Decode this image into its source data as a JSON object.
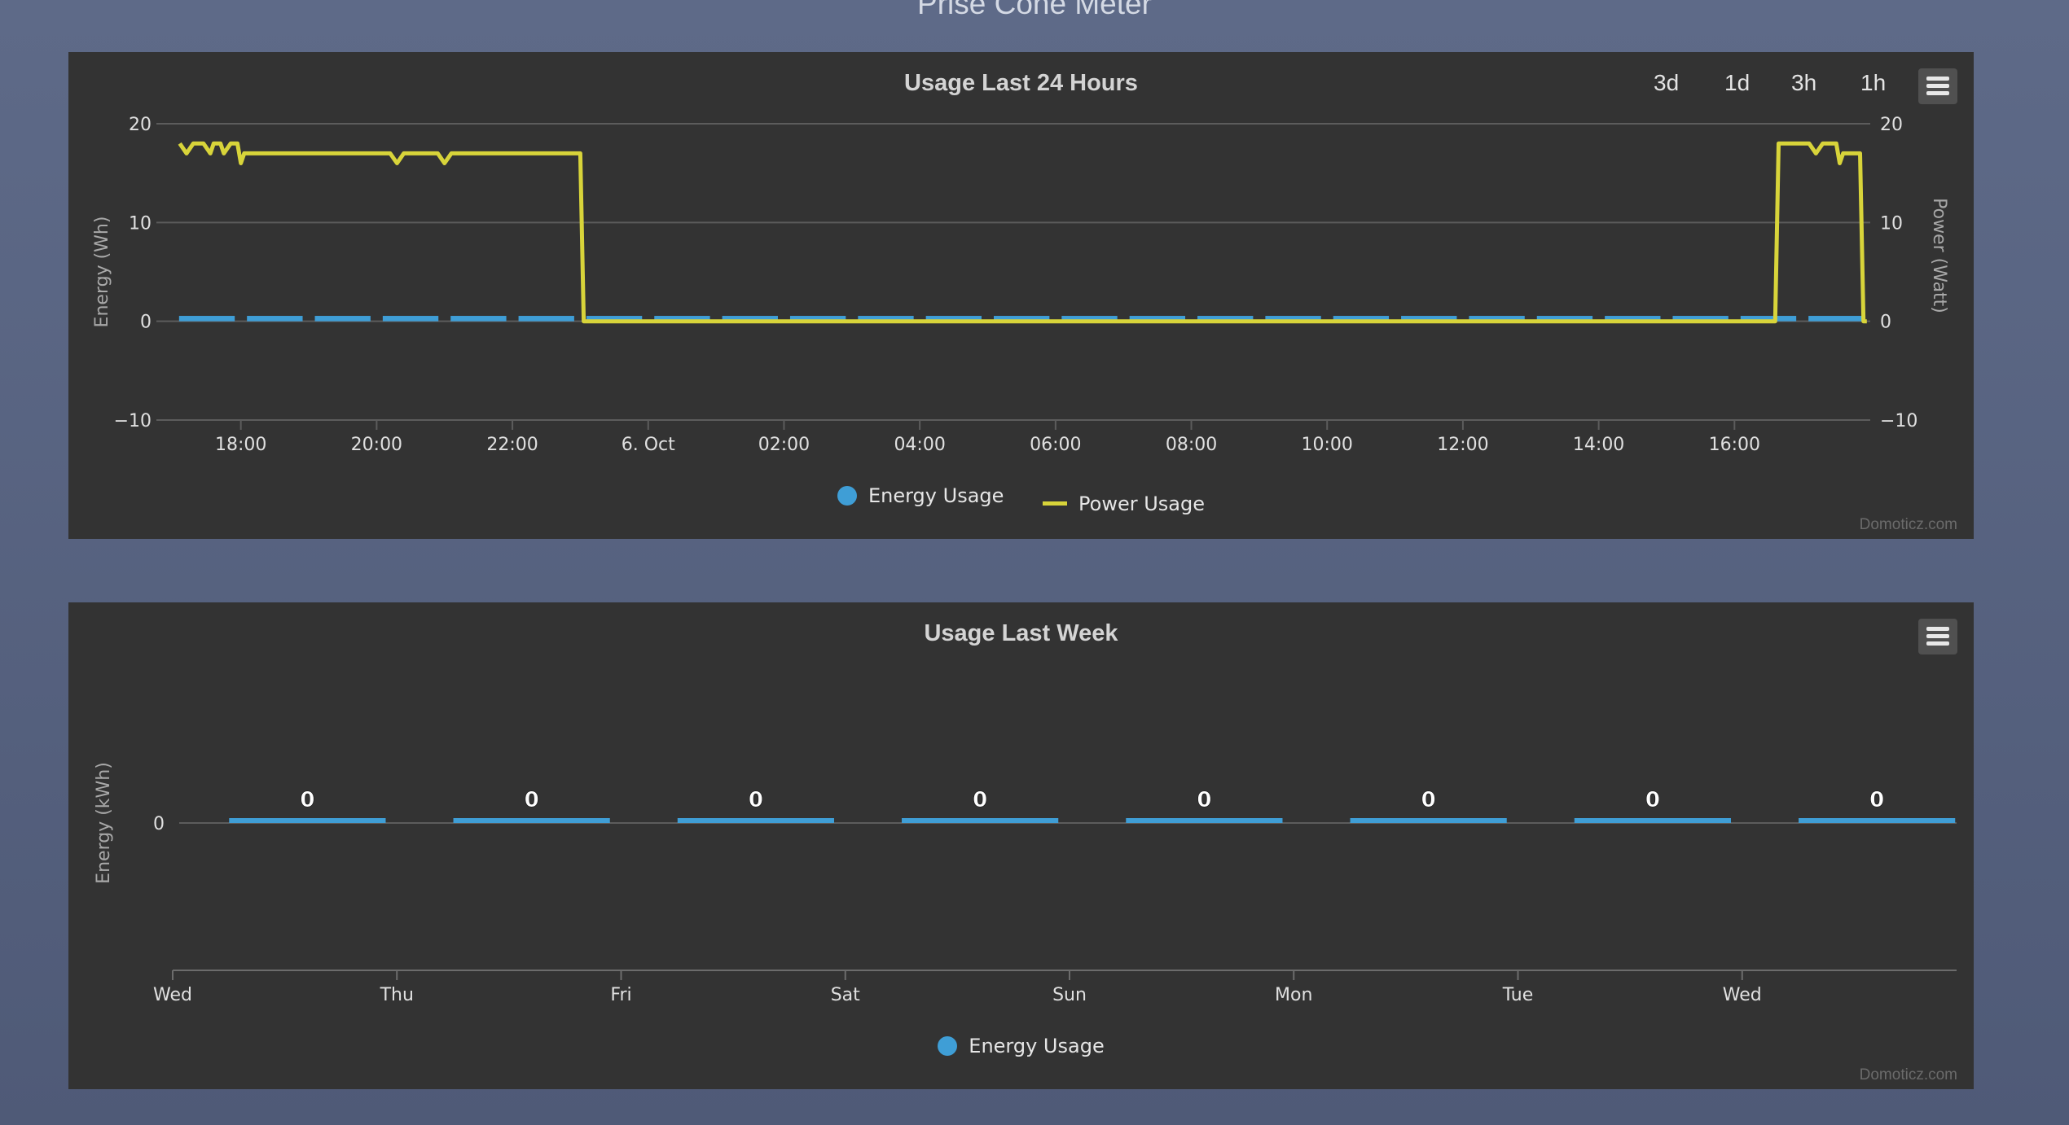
{
  "page_title": "Prise Cone Meter",
  "colors": {
    "energy": "#3f9ed6",
    "power": "#d8d43a"
  },
  "icons": {
    "menu": "hamburger-menu-icon"
  },
  "credit": "Domoticz.com",
  "day_chart": {
    "range_buttons": [
      "3d",
      "1d",
      "3h",
      "1h"
    ]
  },
  "chart_data": [
    {
      "type": "line",
      "title": "Usage Last 24 Hours",
      "ylabel": "Energy (Wh)",
      "y2label": "Power (Watt)",
      "ylim": [
        -10,
        20
      ],
      "y2lim": [
        -10,
        20
      ],
      "yticks": [
        20,
        10,
        0,
        -10
      ],
      "y2ticks": [
        20,
        10,
        0,
        -10
      ],
      "xlim": [
        16.9,
        42.0
      ],
      "xticks": [
        {
          "x": 18,
          "label": "18:00"
        },
        {
          "x": 20,
          "label": "20:00"
        },
        {
          "x": 22,
          "label": "22:00"
        },
        {
          "x": 24,
          "label": "6. Oct"
        },
        {
          "x": 26,
          "label": "02:00"
        },
        {
          "x": 28,
          "label": "04:00"
        },
        {
          "x": 30,
          "label": "06:00"
        },
        {
          "x": 32,
          "label": "08:00"
        },
        {
          "x": 34,
          "label": "10:00"
        },
        {
          "x": 36,
          "label": "12:00"
        },
        {
          "x": 38,
          "label": "14:00"
        },
        {
          "x": 40,
          "label": "16:00"
        }
      ],
      "grid": true,
      "legend": "bottom-center",
      "series": [
        {
          "name": "Energy Usage",
          "kind": "column",
          "x": [
            17.5,
            18.5,
            19.5,
            20.5,
            21.5,
            22.5,
            23.5,
            24.5,
            25.5,
            26.5,
            27.5,
            28.5,
            29.5,
            30.5,
            31.5,
            32.5,
            33.5,
            34.5,
            35.5,
            36.5,
            37.5,
            38.5,
            39.5,
            40.5,
            41.5
          ],
          "values": [
            0.3,
            0.3,
            0.3,
            0.3,
            0.3,
            0.3,
            0.3,
            0.3,
            0.3,
            0.3,
            0.3,
            0.3,
            0.3,
            0.3,
            0.3,
            0.3,
            0.3,
            0.3,
            0.3,
            0.3,
            0.3,
            0.3,
            0.3,
            0.3,
            0.3
          ]
        },
        {
          "name": "Power Usage",
          "kind": "line",
          "x": [
            17.1,
            17.2,
            17.3,
            17.45,
            17.55,
            17.6,
            17.7,
            17.75,
            17.85,
            17.95,
            18.0,
            18.05,
            18.1,
            20.2,
            20.3,
            20.4,
            20.9,
            21.0,
            21.1,
            23.0,
            23.05,
            23.2,
            40.6,
            40.65,
            40.7,
            41.1,
            41.2,
            41.3,
            41.5,
            41.55,
            41.6,
            41.85,
            41.9,
            41.95
          ],
          "values": [
            18,
            17,
            18,
            18,
            17,
            18,
            18,
            17,
            18,
            18,
            16,
            17,
            17,
            17,
            16,
            17,
            17,
            16,
            17,
            17,
            0,
            0,
            0,
            18,
            18,
            18,
            17,
            18,
            18,
            16,
            17,
            17,
            0,
            0
          ]
        }
      ]
    },
    {
      "type": "bar",
      "title": "Usage Last Week",
      "ylabel": "Energy (kWh)",
      "categories": [
        "Wed",
        "Thu",
        "Fri",
        "Sat",
        "Sun",
        "Mon",
        "Tue",
        "Wed"
      ],
      "values": [
        0,
        0,
        0,
        0,
        0,
        0,
        0,
        0
      ],
      "data_labels": [
        "0",
        "0",
        "0",
        "0",
        "0",
        "0",
        "0",
        "0"
      ],
      "yticks": [
        0
      ],
      "grid": true,
      "legend": "bottom-center",
      "series": [
        {
          "name": "Energy Usage",
          "values": [
            0,
            0,
            0,
            0,
            0,
            0,
            0,
            0
          ]
        }
      ]
    }
  ]
}
